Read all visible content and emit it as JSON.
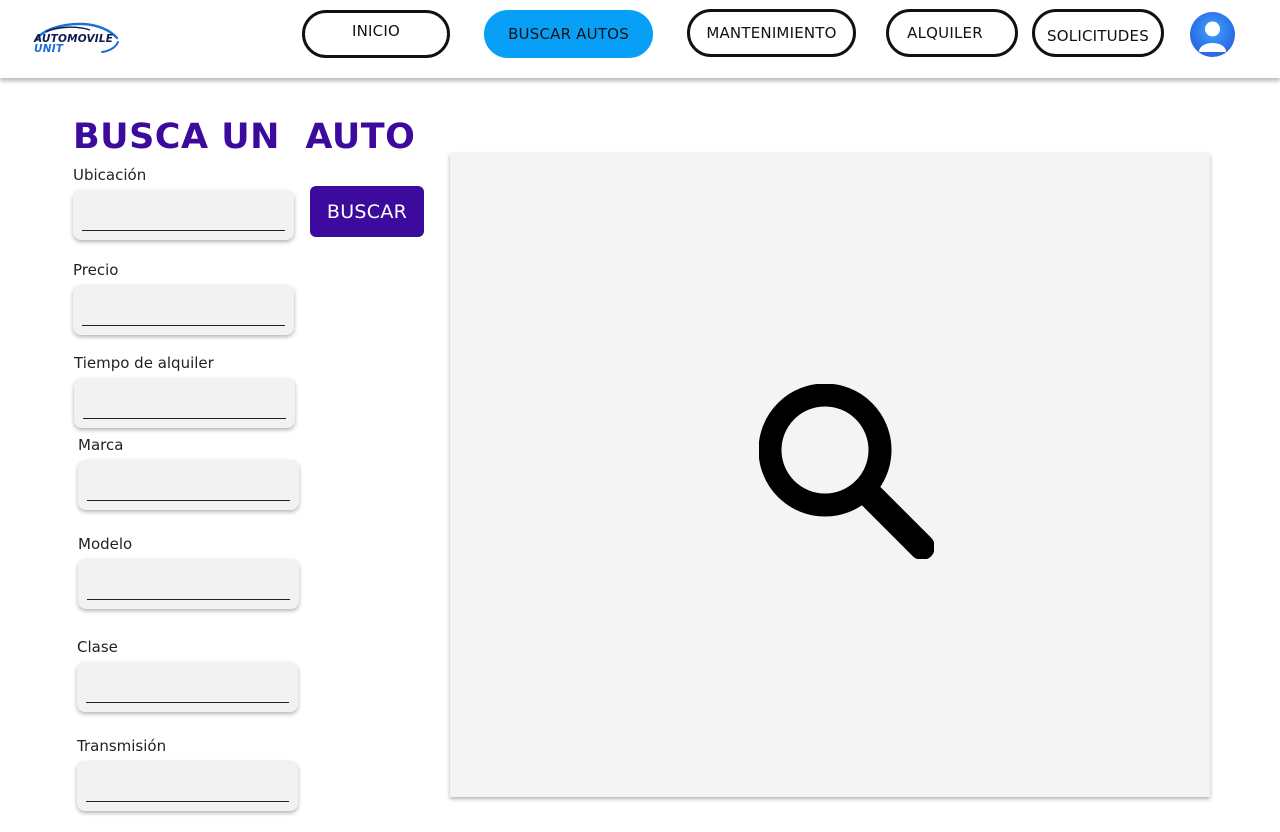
{
  "header": {
    "logo": {
      "line1": "AUTOMOVILE",
      "line2": "UNIT"
    },
    "nav": [
      {
        "label": "INICIO",
        "active": false
      },
      {
        "label": "BUSCAR AUTOS",
        "active": true
      },
      {
        "label": "MANTENIMIENTO",
        "active": false
      },
      {
        "label": "ALQUILER",
        "active": false
      },
      {
        "label": "SOLICITUDES",
        "active": false
      }
    ],
    "avatar_icon": "user-avatar-icon"
  },
  "search_form": {
    "title": "BUSCA UN  AUTO",
    "button_label": "BUSCAR",
    "fields": [
      {
        "label": "Ubicación",
        "value": ""
      },
      {
        "label": "Precio",
        "value": ""
      },
      {
        "label": "Tiempo de alquiler",
        "value": ""
      },
      {
        "label": "Marca",
        "value": ""
      },
      {
        "label": "Modelo",
        "value": ""
      },
      {
        "label": "Clase",
        "value": ""
      },
      {
        "label": "Transmisión",
        "value": ""
      }
    ]
  },
  "results": {
    "icon": "search-icon"
  },
  "colors": {
    "accent": "#3d0a9e",
    "active_nav": "#08a0f7",
    "panel_bg": "#f4f4f4"
  }
}
